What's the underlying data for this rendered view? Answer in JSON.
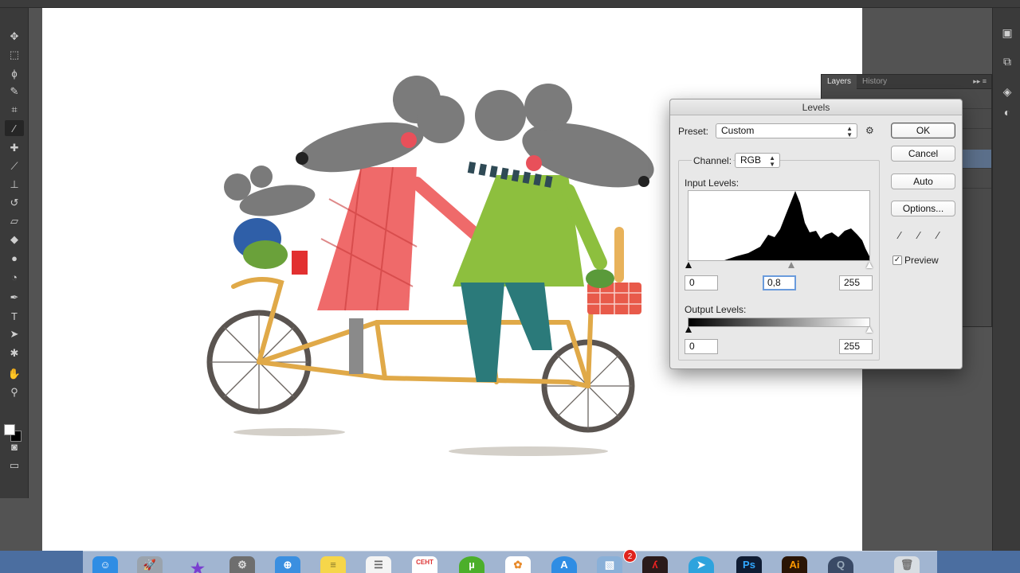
{
  "layers_panel": {
    "tabs": [
      "Layers",
      "History"
    ],
    "menu_glyph": "▸▸ ≡"
  },
  "levels_dialog": {
    "title": "Levels",
    "preset_label": "Preset:",
    "preset_value": "Custom",
    "channel_label": "Channel:",
    "channel_value": "RGB",
    "input_levels_label": "Input Levels:",
    "input_black": "0",
    "input_gamma": "0,8",
    "input_white": "255",
    "output_levels_label": "Output Levels:",
    "output_black": "0",
    "output_white": "255",
    "buttons": {
      "ok": "OK",
      "cancel": "Cancel",
      "auto": "Auto",
      "options": "Options..."
    },
    "preview_label": "Preview",
    "preview_checked": true
  },
  "dock": {
    "calendar_month": "СЕНТ",
    "notification_count": "2",
    "apps": [
      "finder-icon",
      "launchpad-icon",
      "imovie-icon",
      "system-preferences-icon",
      "safari-icon",
      "notes-icon",
      "reminders-icon",
      "calendar-icon",
      "utorrent-icon",
      "photos-icon",
      "app-store-icon",
      "preview-icon",
      "acrobat-icon",
      "telegram-icon",
      "photoshop-icon",
      "illustrator-icon",
      "quicktime-icon",
      "trash-icon"
    ],
    "ps_label": "Ps",
    "ai_label": "Ai"
  },
  "colors": {
    "ui_dark": "#3a3a3a",
    "canvas": "#ffffff",
    "dialog_bg": "#e8e8e8",
    "selection_blue": "#5b6f8a",
    "focus_ring": "#6a9bdc"
  }
}
